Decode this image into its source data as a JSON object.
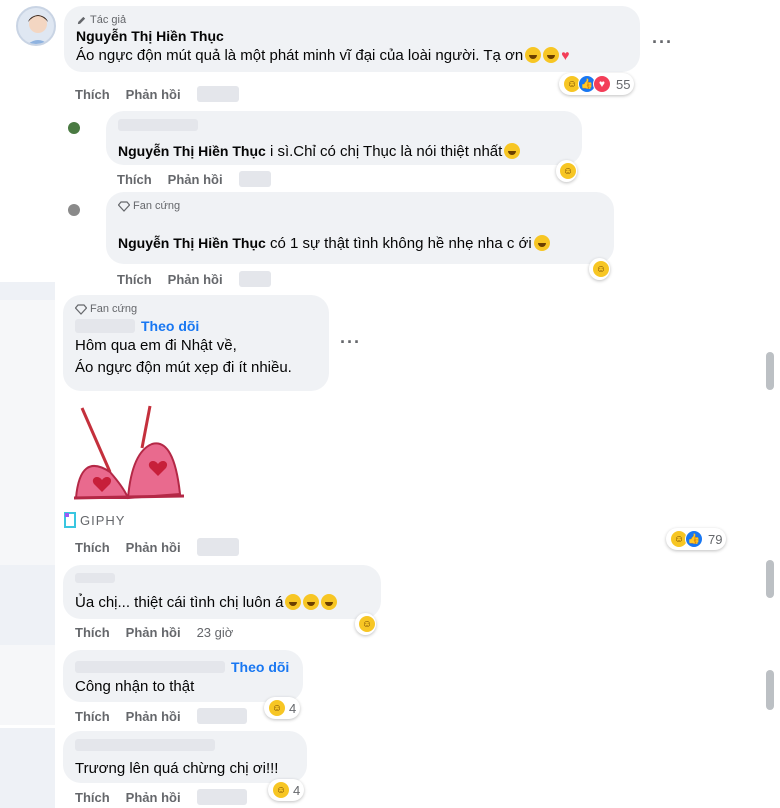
{
  "comments": [
    {
      "badge": "Tác giả",
      "author": "Nguyễn Thị Hiền Thục",
      "text": "Áo ngực độn mút quả là một phát minh vĩ đại của loài người. Tạ ơn",
      "reaction_count": "55"
    },
    {
      "author": "Nguyễn Thị Hiền Thục",
      "text": "i sì.Chỉ có chị Thục là nói thiệt nhất"
    },
    {
      "badge": "Fan cứng",
      "author": "Nguyễn Thị Hiền Thục",
      "text": "có 1 sự thật tình không hề nhẹ nha c ới"
    },
    {
      "badge": "Fan cứng",
      "follow": "Theo dõi",
      "line1": "Hôm qua em đi Nhật về,",
      "line2": "Áo ngực độn mút xẹp đi ít nhiều.",
      "gif_label": "GIPHY",
      "reaction_count": "79"
    },
    {
      "text": "Ủa chị... thiệt cái tình chị luôn á",
      "time": "23 giờ"
    },
    {
      "follow": "Theo dõi",
      "text": "Công nhận to thật",
      "reaction_count": "4"
    },
    {
      "text": "Trương lên quá chừng chị ơi!!!",
      "reaction_count": "4"
    }
  ],
  "actions": {
    "like": "Thích",
    "reply": "Phản hồi"
  },
  "icons": [
    "pencil-icon",
    "diamond-icon",
    "more-icon",
    "haha-icon",
    "like-icon",
    "love-icon",
    "giphy-icon"
  ],
  "colors": {
    "bubble": "#f0f2f5",
    "link": "#1877f2",
    "muted": "#65676b"
  }
}
